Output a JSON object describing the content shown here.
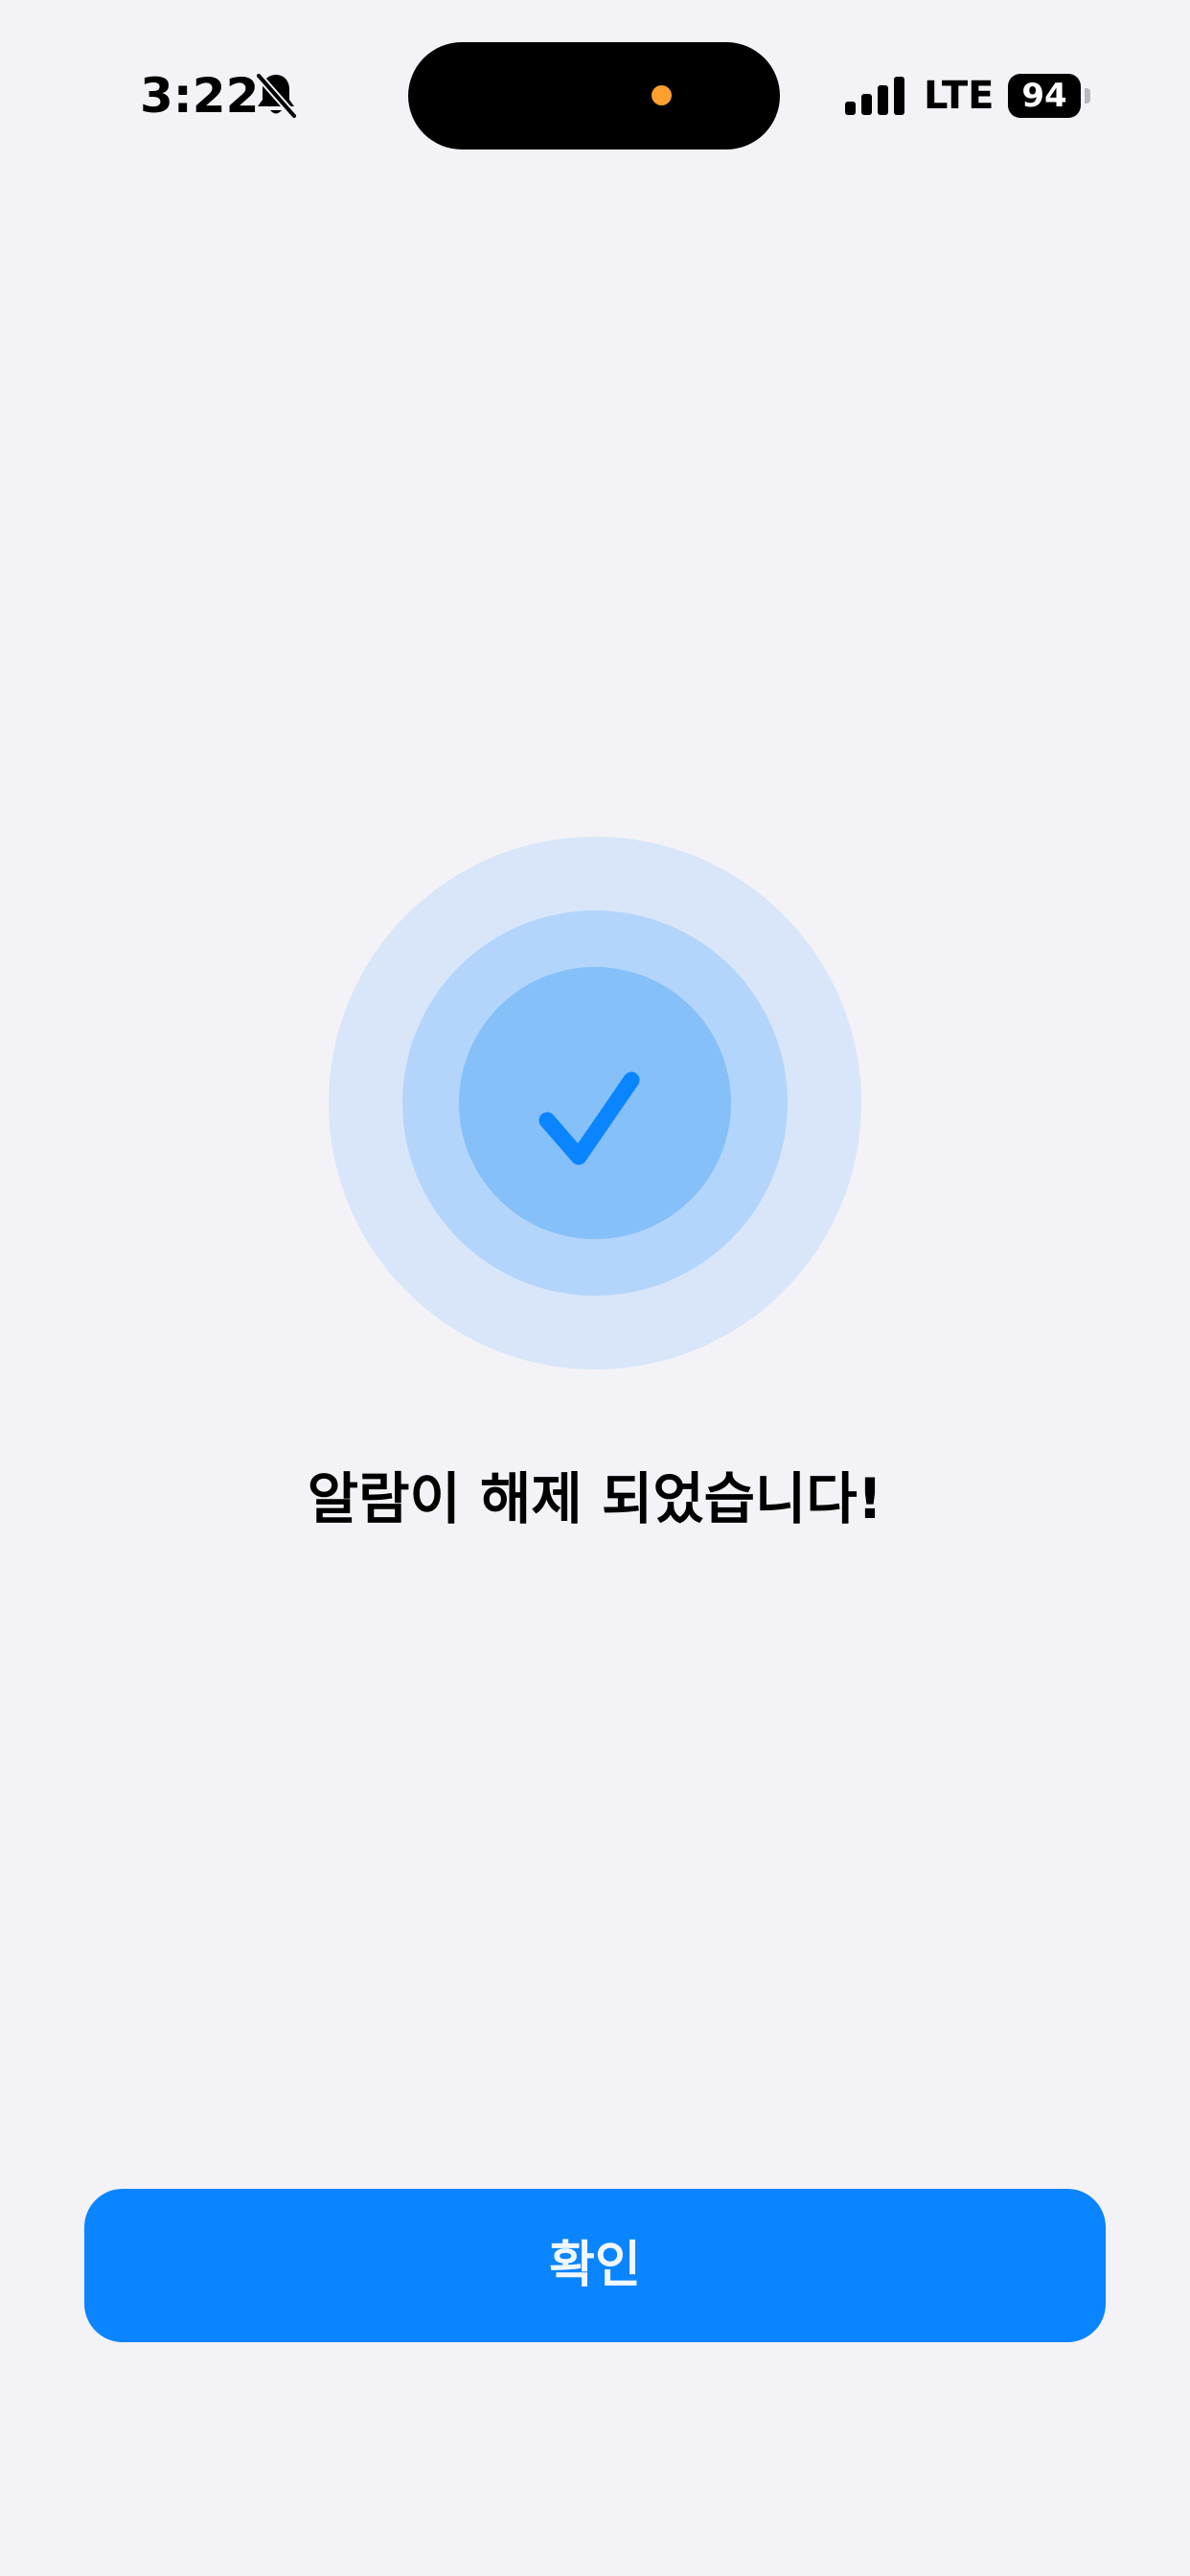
{
  "status_bar": {
    "time": "3:22",
    "silent_icon": "bell-slash-icon",
    "network": "LTE",
    "battery_level": "94",
    "signal_icon": "cellular-signal-icon"
  },
  "success": {
    "icon": "checkmark-icon",
    "message": "알람이 해제 되었습니다!"
  },
  "confirm_button": {
    "label": "확인"
  },
  "colors": {
    "background": "#f2f2f7",
    "accent": "#0a84ff",
    "ring_outer": "#d9e6f9",
    "ring_middle": "#b4d5fb",
    "ring_inner": "#85c0f9",
    "privacy_dot": "#ff9f2e"
  }
}
